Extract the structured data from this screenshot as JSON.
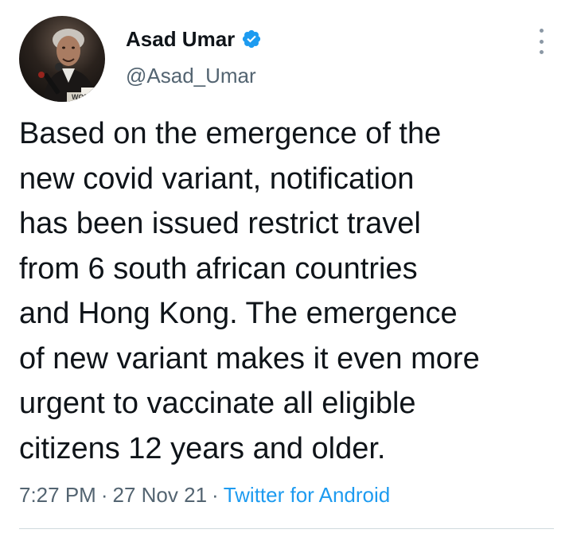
{
  "author": {
    "display_name": "Asad Umar",
    "handle": "@Asad_Umar",
    "verified_icon": "verified-badge-icon",
    "avatar_caption": "WORL"
  },
  "menu": {
    "icon": "more-options-icon"
  },
  "tweet": {
    "lines": [
      "Based on the emergence of the",
      "new covid variant, notification",
      "has been issued restrict travel",
      "from 6 south african countries",
      "and Hong Kong. The emergence",
      "of new variant makes it even more",
      "urgent to vaccinate all eligible",
      "citizens 12 years and older."
    ]
  },
  "meta": {
    "time": "7:27 PM",
    "separator": "·",
    "date": "27 Nov 21",
    "source": "Twitter for Android"
  },
  "colors": {
    "text": "#0f1419",
    "secondary": "#536471",
    "link": "#1d9bf0",
    "verified": "#1d9bf0",
    "divider": "#cfd9de"
  }
}
